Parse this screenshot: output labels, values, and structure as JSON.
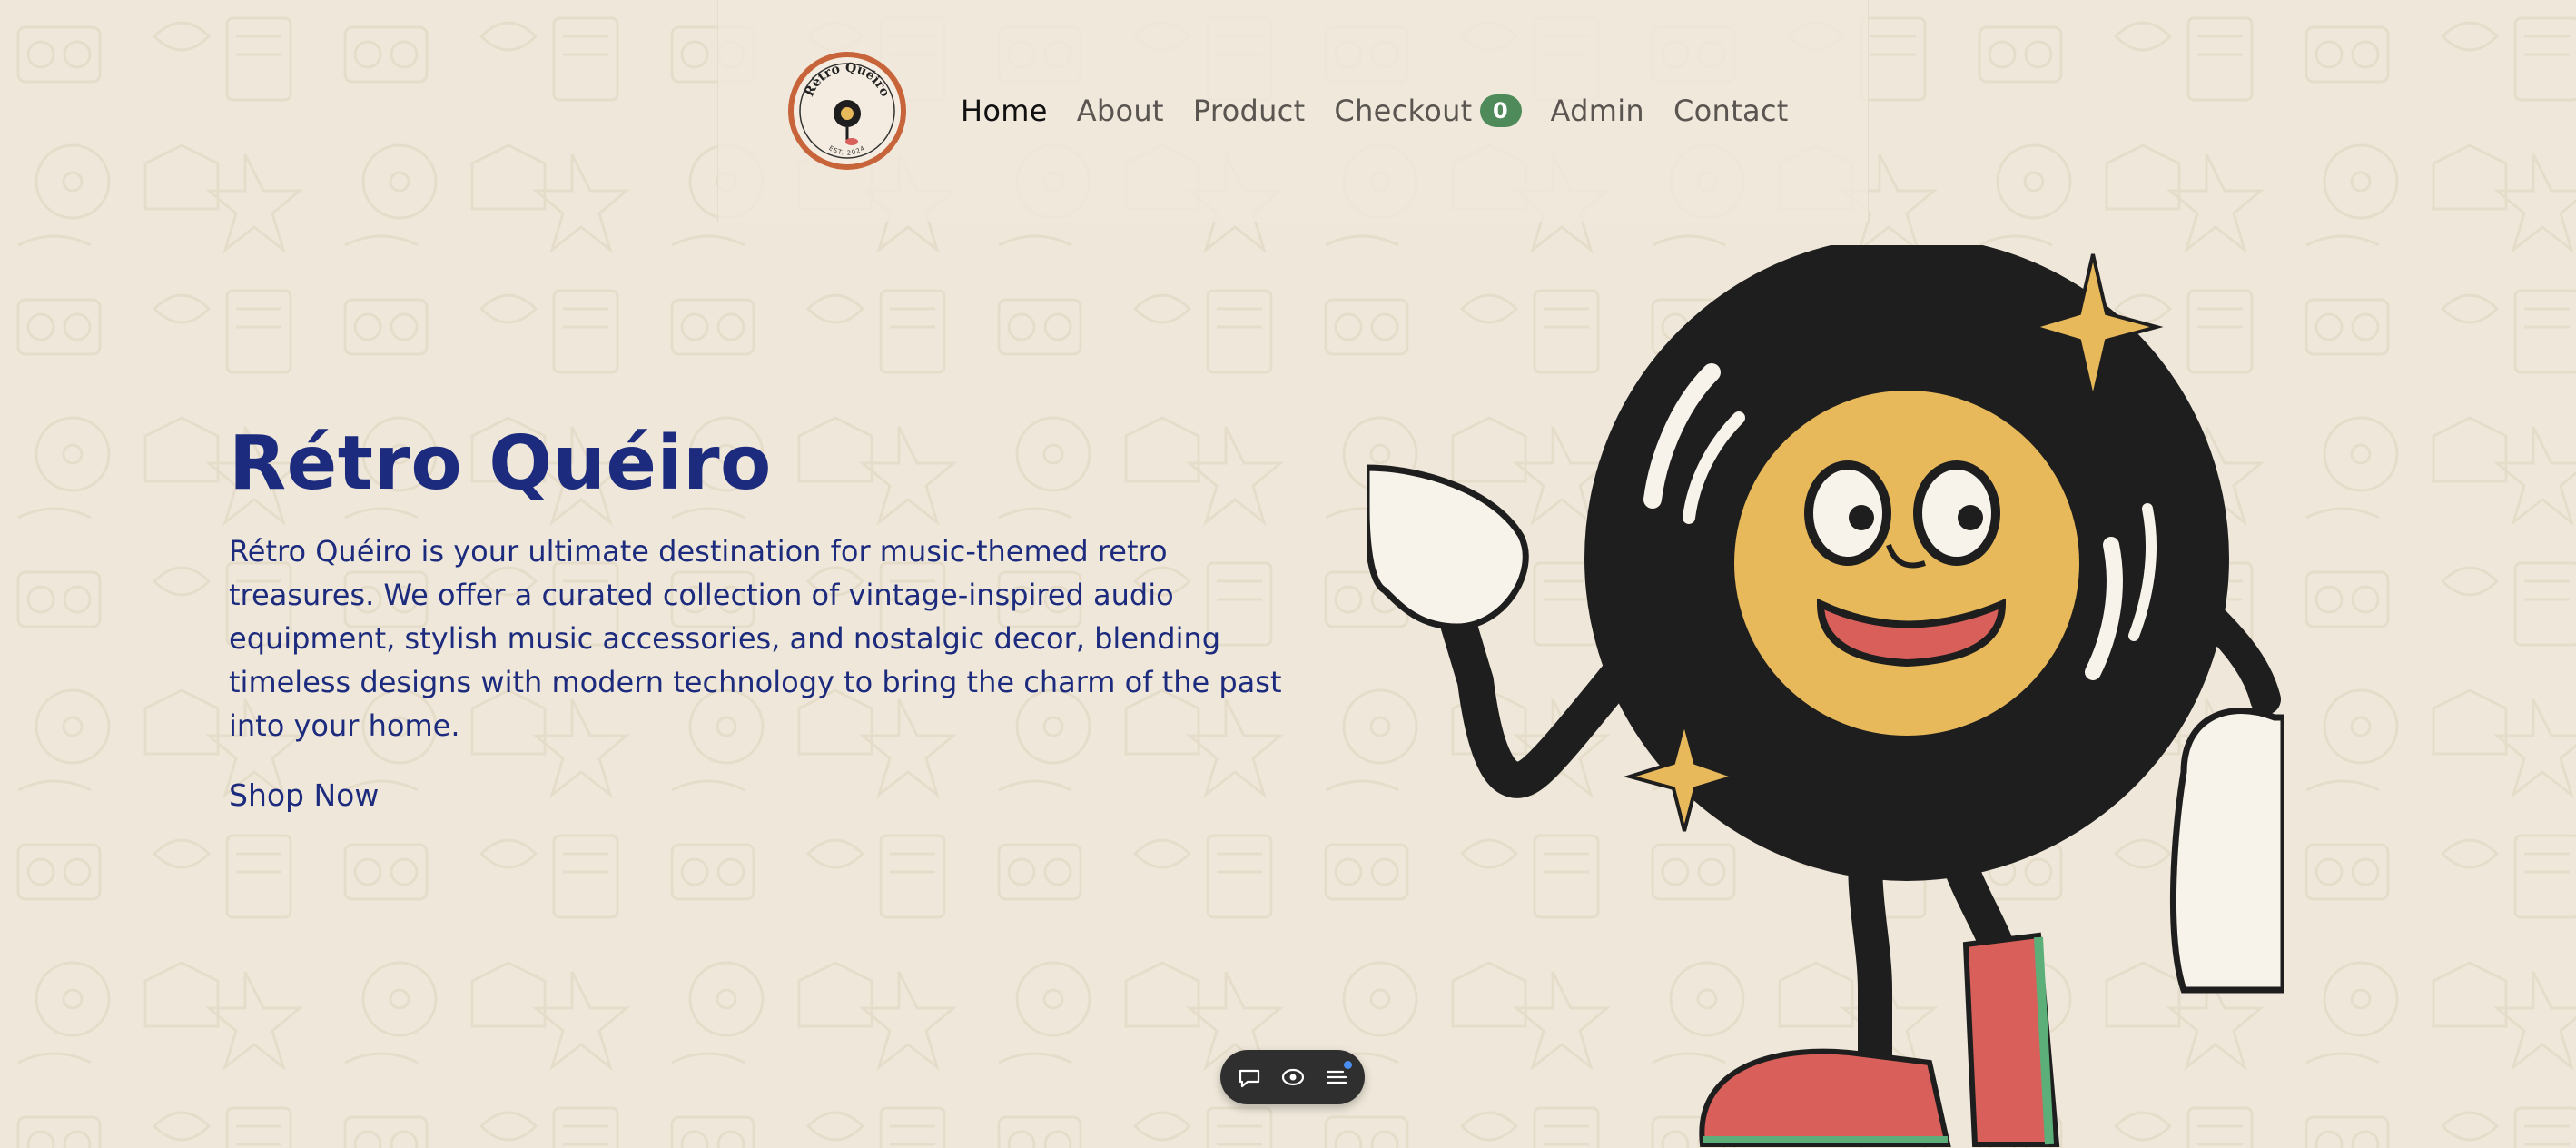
{
  "brand": {
    "logo_name": "Rétro Quéiro",
    "logo_sub": "EST. 2024"
  },
  "nav": {
    "items": [
      {
        "label": "Home",
        "active": true
      },
      {
        "label": "About",
        "active": false
      },
      {
        "label": "Product",
        "active": false
      },
      {
        "label": "Checkout",
        "active": false
      },
      {
        "label": "Admin",
        "active": false
      },
      {
        "label": "Contact",
        "active": false
      }
    ],
    "cart_count": "0"
  },
  "hero": {
    "title": "Rétro Quéiro",
    "description": "Rétro Quéiro is your ultimate destination for music-themed retro treasures. We offer a curated collection of vintage-inspired audio equipment, stylish music accessories, and nostalgic decor, blending timeless designs with modern technology to bring the charm of the past into your home.",
    "cta_label": "Shop Now"
  },
  "toolbar": {
    "icons": [
      "comment-icon",
      "preview-eye-icon",
      "menu-list-icon"
    ]
  },
  "colors": {
    "background": "#efe8da",
    "title_blue": "#1c2b7d",
    "badge_green": "#4e8a5a",
    "record_black": "#1e1e1e",
    "label_yellow": "#e8b95a",
    "shoe_red": "#d85f5a",
    "toolbar_dark": "#2f2f2f"
  }
}
